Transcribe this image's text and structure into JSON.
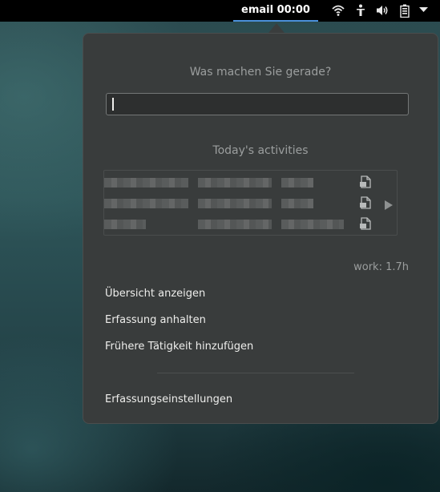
{
  "topbar": {
    "tracker_label": "email 00:00",
    "icons": [
      "wifi-icon",
      "accessibility-icon",
      "volume-icon",
      "battery-icon",
      "system-menu-arrow-icon"
    ]
  },
  "popup": {
    "question": "Was machen Sie gerade?",
    "activity_input": {
      "value": "",
      "placeholder": ""
    },
    "todays_heading": "Today's activities",
    "activities": [
      {
        "redacted": true,
        "icons": [
          "edit-document-icon"
        ]
      },
      {
        "redacted": true,
        "icons": [
          "edit-document-icon",
          "resume-play-icon"
        ]
      },
      {
        "redacted": true,
        "icons": [
          "edit-document-icon"
        ]
      }
    ],
    "work_total": "work: 1.7h",
    "menu": {
      "overview": "Übersicht anzeigen",
      "stop_tracking": "Erfassung anhalten",
      "add_earlier": "Frühere Tätigkeit hinzufügen",
      "settings": "Erfassungseinstellungen"
    }
  },
  "colors": {
    "panel_bg": "#000000",
    "popup_bg": "#393c3c",
    "accent_underline": "#4a90d9",
    "muted_text": "#9b9e9e",
    "text": "#eeeeec"
  }
}
